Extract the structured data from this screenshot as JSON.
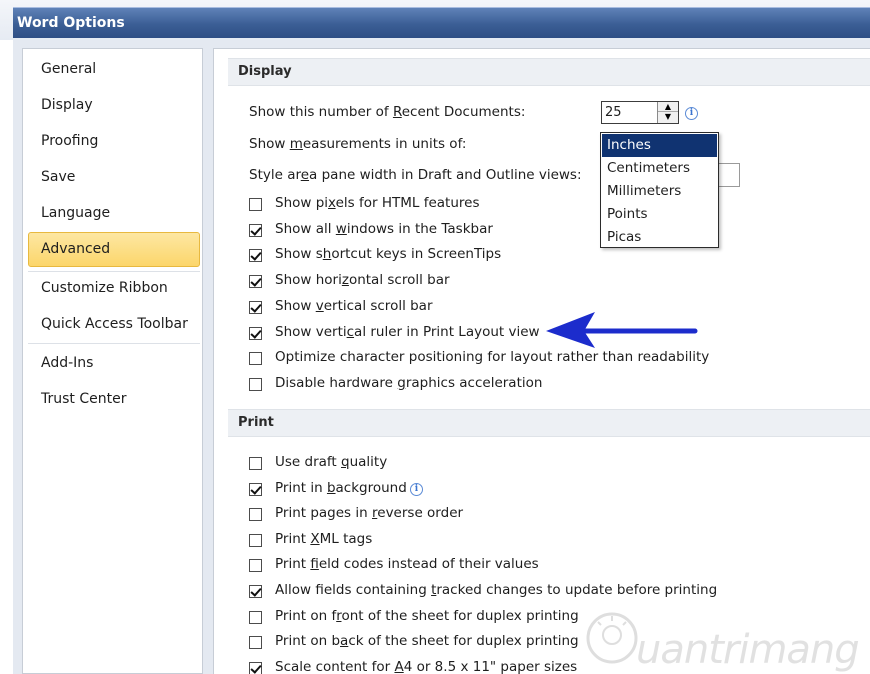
{
  "window": {
    "title": "Word Options"
  },
  "sidebar": {
    "items": [
      {
        "label": "General"
      },
      {
        "label": "Display"
      },
      {
        "label": "Proofing"
      },
      {
        "label": "Save"
      },
      {
        "label": "Language"
      },
      {
        "label": "Advanced",
        "selected": true
      },
      {
        "label": "Customize Ribbon"
      },
      {
        "label": "Quick Access Toolbar"
      },
      {
        "label": "Add-Ins"
      },
      {
        "label": "Trust Center"
      }
    ]
  },
  "display_section": {
    "header": "Display",
    "recent_docs": {
      "pre": "Show this number of ",
      "key": "R",
      "post": "ecent Documents:",
      "value": "25"
    },
    "measurement_units": {
      "pre": "Show ",
      "key": "m",
      "post": "easurements in units of:",
      "selected": "Inches",
      "options": [
        "Inches",
        "Centimeters",
        "Millimeters",
        "Points",
        "Picas"
      ]
    },
    "style_area": {
      "pre": "Style ar",
      "key": "e",
      "post": "a pane width in Draft and Outline views:"
    },
    "checkboxes": [
      {
        "pre": "Show pi",
        "key": "x",
        "post": "els for HTML features",
        "checked": false
      },
      {
        "pre": "Show all ",
        "key": "w",
        "post": "indows in the Taskbar",
        "checked": true
      },
      {
        "pre": "Show s",
        "key": "h",
        "post": "ortcut keys in ScreenTips",
        "checked": true
      },
      {
        "pre": "Show hori",
        "key": "z",
        "post": "ontal scroll bar",
        "checked": true
      },
      {
        "pre": "Show ",
        "key": "v",
        "post": "ertical scroll bar",
        "checked": true
      },
      {
        "pre": "Show verti",
        "key": "c",
        "post": "al ruler in Print Layout view",
        "checked": true
      },
      {
        "pre": "Optimize character positioning for layout rather than readability",
        "key": "",
        "post": "",
        "checked": false
      },
      {
        "pre": "Disable hardware ",
        "key": "g",
        "post": "raphics acceleration",
        "checked": false
      }
    ]
  },
  "print_section": {
    "header": "Print",
    "checkboxes": [
      {
        "pre": "Use draft ",
        "key": "q",
        "post": "uality",
        "checked": false
      },
      {
        "pre": "Print in ",
        "key": "b",
        "post": "ackground",
        "checked": true,
        "info": true
      },
      {
        "pre": "Print pages in ",
        "key": "r",
        "post": "everse order",
        "checked": false
      },
      {
        "pre": "Print ",
        "key": "X",
        "post": "ML tags",
        "checked": false
      },
      {
        "pre": "Print ",
        "key": "f",
        "post": "ield codes instead of their values",
        "checked": false
      },
      {
        "pre": "Allow fields containing ",
        "key": "t",
        "post": "racked changes to update before printing",
        "checked": true
      },
      {
        "pre": "Print on f",
        "key": "r",
        "post": "ont of the sheet for duplex printing",
        "checked": false
      },
      {
        "pre": "Print on b",
        "key": "a",
        "post": "ck of the sheet for duplex printing",
        "checked": false
      },
      {
        "pre": "Scale content for ",
        "key": "A",
        "post": "4 or 8.5 x 11\" paper sizes",
        "checked": true
      }
    ]
  },
  "annotation": {
    "arrow_color": "#1c2ccc"
  },
  "watermark": {
    "text": "uantrimang"
  },
  "colors": {
    "title_bar": "#3b5e95",
    "nav_active": "#fcd66b",
    "dropdown_selected": "#103371"
  },
  "icons": {
    "info": "info-icon",
    "spin": "spin-arrows-icon",
    "arrow": "left-arrow-icon"
  }
}
